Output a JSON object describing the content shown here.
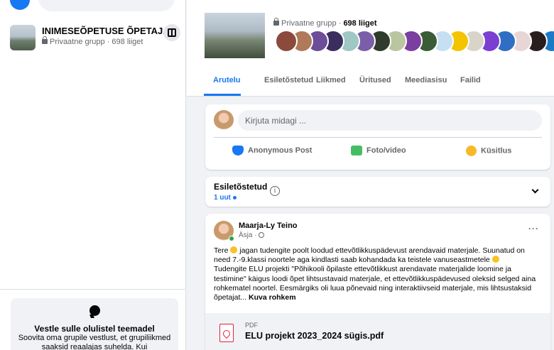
{
  "sidebar": {
    "group": {
      "name": "INIMESEÕPETUSE ÕPETAJAD",
      "meta": "Privaatne grupp · 698 liiget"
    },
    "chat_card": {
      "title": "Vestle sulle olulistel teemadel",
      "description": "Soovita oma grupile vestlust, et grupiliikmed saaksid reaalajas suhelda. Kui"
    }
  },
  "header": {
    "privacy": "Privaatne grupp · ",
    "members": "698 liiget",
    "member_avatar_colors": [
      "#8b4a3c",
      "#b07a5a",
      "#6d4c9a",
      "#3b2d5e",
      "#9fc7c3",
      "#7a5fa8",
      "#2f3b2d",
      "#b9c6a0",
      "#7a3fa0",
      "#3a5c36",
      "#c6dff2",
      "#f4c400",
      "#d9d4c9",
      "#7b3fd1",
      "#2f6ec4",
      "#e8d6d6",
      "#2a1d1d",
      "#1b7ac7"
    ],
    "tabs": [
      "Arutelu",
      "Esiletõstetud",
      "Liikmed",
      "Üritused",
      "Meediasisu",
      "Failid"
    ],
    "active_tab": "Arutelu"
  },
  "composer": {
    "placeholder": "Kirjuta midagi ...",
    "actions": [
      {
        "label": "Anonymous Post",
        "icon": "anonymous-icon",
        "color": "#1877f2"
      },
      {
        "label": "Foto/video",
        "icon": "photo-icon",
        "color": "#45bd62"
      },
      {
        "label": "Küsitlus",
        "icon": "poll-icon",
        "color": "#f7b928"
      }
    ]
  },
  "featured": {
    "title": "Esiletõstetud",
    "new_count": "1 uut"
  },
  "post": {
    "author": "Maarja-Ly Teino",
    "time": "Äsja · ",
    "lines": [
      [
        "Tere ",
        " jagan tudengite poolt loodud ettevõtlikkuspädevust arendavaid materjale.  Suunatud on"
      ],
      [
        "need 7.-9.klassi noortele aga kindlasti saab kohandada ka teistele vanuseastmetele ",
        ""
      ],
      [
        "Tudengite ELU projekti \"Põhikooli õpilaste ettevõtlikkust arendavate materjalide loomine ja",
        null
      ],
      [
        "testimine\" käigus loodi õpet lihtsustavaid materjale, et ettevõtlikkuspädevused oleksid selged aina",
        null
      ],
      [
        "rohkematel noortel. Eesmärgiks oli luua põnevaid ning interaktiivseid materjale, mis lihtsustaksid",
        null
      ],
      [
        "õpetajat... ",
        null
      ]
    ],
    "see_more": "Kuva rohkem",
    "attachment": {
      "type": "PDF",
      "filename": "ELU projekt 2023_2024 sügis.pdf"
    }
  }
}
